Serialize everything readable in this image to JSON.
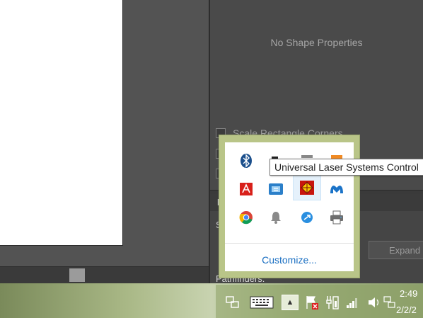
{
  "properties_panel": {
    "empty_message": "No Shape Properties",
    "scale_corners_label": "Scale Rectangle Corners"
  },
  "lower_panel": {
    "header_initial": "P",
    "s_initial": "S",
    "expand_label": "Expand",
    "pathfinders_label": "Pathfinders:"
  },
  "tray_popup": {
    "tooltip": "Universal Laser Systems Control",
    "customize_label": "Customize...",
    "icons": [
      "bluetooth-icon",
      "camera-icon",
      "display-icon",
      "app-icon",
      "adobe-icon",
      "network-icon",
      "universal-laser-icon",
      "malwarebytes-icon",
      "chrome-icon",
      "notification-bell-icon",
      "dropbox-icon",
      "printer-icon"
    ]
  },
  "taskbar": {
    "time": "2:49",
    "date": "2/2/2",
    "overflow_arrow": "▲"
  },
  "colors": {
    "panel_bg": "#4a4a4a",
    "link_blue": "#1a6fc2",
    "tray_bg": "#b9c588"
  }
}
